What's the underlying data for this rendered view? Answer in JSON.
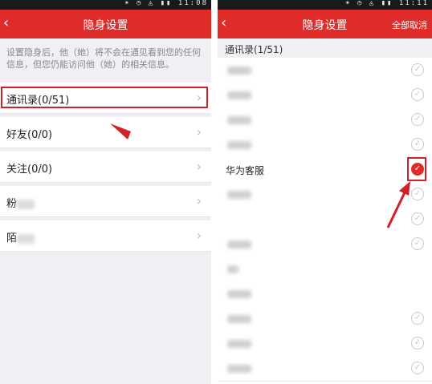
{
  "left_screen": {
    "status_time": "11:08",
    "title": "隐身设置",
    "back_icon": "back-chevron-icon",
    "description": "设置隐身后，他（她）将不会在通见看到您的任何信息，但您仍能访问他（她）的相关信息。",
    "rows": [
      {
        "label": "通讯录(0/51)"
      },
      {
        "label": "好友(0/0)"
      },
      {
        "label": "关注(0/0)"
      },
      {
        "label": "粉"
      },
      {
        "label": "陌"
      }
    ]
  },
  "right_screen": {
    "status_time": "11:11",
    "title": "隐身设置",
    "action": "全部取消",
    "section_header": "通讯录(1/51)",
    "contacts": [
      {
        "name": "",
        "checked": false
      },
      {
        "name": "",
        "checked": false
      },
      {
        "name": "",
        "checked": false
      },
      {
        "name": "",
        "checked": false
      },
      {
        "name": "华为客服",
        "checked": true
      },
      {
        "name": "",
        "checked": false
      },
      {
        "name": "",
        "checked": false
      },
      {
        "name": "",
        "checked": false
      },
      {
        "name": "",
        "checked": false
      },
      {
        "name": "",
        "checked": false
      },
      {
        "name": "",
        "checked": false
      },
      {
        "name": "",
        "checked": false
      },
      {
        "name": "",
        "checked": false
      }
    ]
  },
  "colors": {
    "accent": "#e02b2b",
    "highlight": "#d32026"
  },
  "check_icon": "✓",
  "chevron_icon": "›"
}
